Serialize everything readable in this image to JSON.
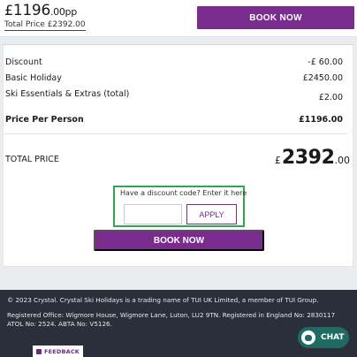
{
  "header": {
    "price_currency": "£",
    "price_main": "1196",
    "price_suffix": ".00pp",
    "total_price_text": "Total Price £2392.00",
    "book_now_label": "BOOK NOW"
  },
  "summary": {
    "rows": [
      {
        "label": "Discount",
        "value": "-£ 60.00"
      },
      {
        "label": "Basic Holiday",
        "value": "£2450.00"
      },
      {
        "label": "Ski Essentials & Extras (total)",
        "value": "£2.00"
      },
      {
        "label": "Price Per Person",
        "value": "£1196.00"
      }
    ],
    "total_label": "TOTAL PRICE",
    "total_currency": "£",
    "total_main": "2392",
    "total_decimal": ".00"
  },
  "discount": {
    "prompt": "Have a discount code? Enter it here",
    "input_value": "",
    "apply_label": "APPLY"
  },
  "book_now_main_label": "BOOK NOW",
  "footer": {
    "line1": "© 2023 Crystal. Crystal Ski Holidays is a trading name of TUI UK Limited, a member of TUI Group.",
    "line2": "Registered Office: Wigmore House, Wigmore Lane, Luton, LU2 9TN. Registered in England No: 2830117 ATOL No: 2524. ABTA No: V5126."
  },
  "chat_label": "CHAT",
  "feedback_label": "FEEDBACK",
  "colors": {
    "accent_purple": "#7a2c8e",
    "highlight_green": "#2fa84f",
    "footer_bg": "#2a2f3a",
    "chat_teal": "#1f6b63"
  }
}
